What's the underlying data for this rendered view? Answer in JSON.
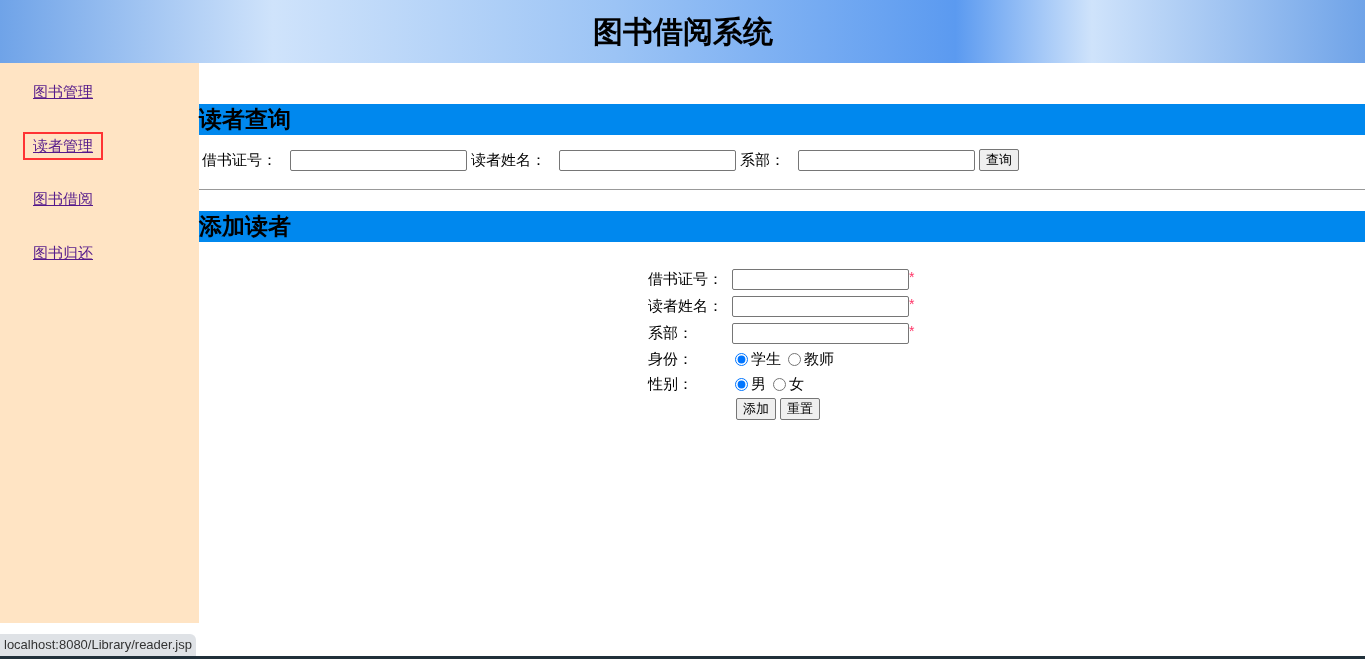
{
  "header": {
    "title": "图书借阅系统"
  },
  "sidebar": {
    "items": [
      {
        "label": "图书管理",
        "highlighted": false
      },
      {
        "label": "读者管理",
        "highlighted": true
      },
      {
        "label": "图书借阅",
        "highlighted": false
      },
      {
        "label": "图书归还",
        "highlighted": false
      }
    ]
  },
  "query": {
    "title": "读者查询",
    "fields": [
      {
        "label": "借书证号："
      },
      {
        "label": "读者姓名："
      },
      {
        "label": "系部："
      }
    ],
    "button": "查询"
  },
  "add": {
    "title": "添加读者",
    "fields": [
      {
        "kind": "text",
        "label": "借书证号：",
        "marker": "*"
      },
      {
        "kind": "text",
        "label": "读者姓名：",
        "marker": "*"
      },
      {
        "kind": "text",
        "label": "系部：",
        "marker": "*"
      },
      {
        "kind": "radio",
        "label": "身份：",
        "options": [
          {
            "label": "学生",
            "selected": true
          },
          {
            "label": "教师",
            "selected": false
          }
        ]
      },
      {
        "kind": "radio",
        "label": "性别：",
        "options": [
          {
            "label": "男",
            "selected": true
          },
          {
            "label": "女",
            "selected": false
          }
        ]
      }
    ],
    "buttons": [
      "添加",
      "重置"
    ]
  },
  "status_url": "localhost:8080/Library/reader.jsp"
}
